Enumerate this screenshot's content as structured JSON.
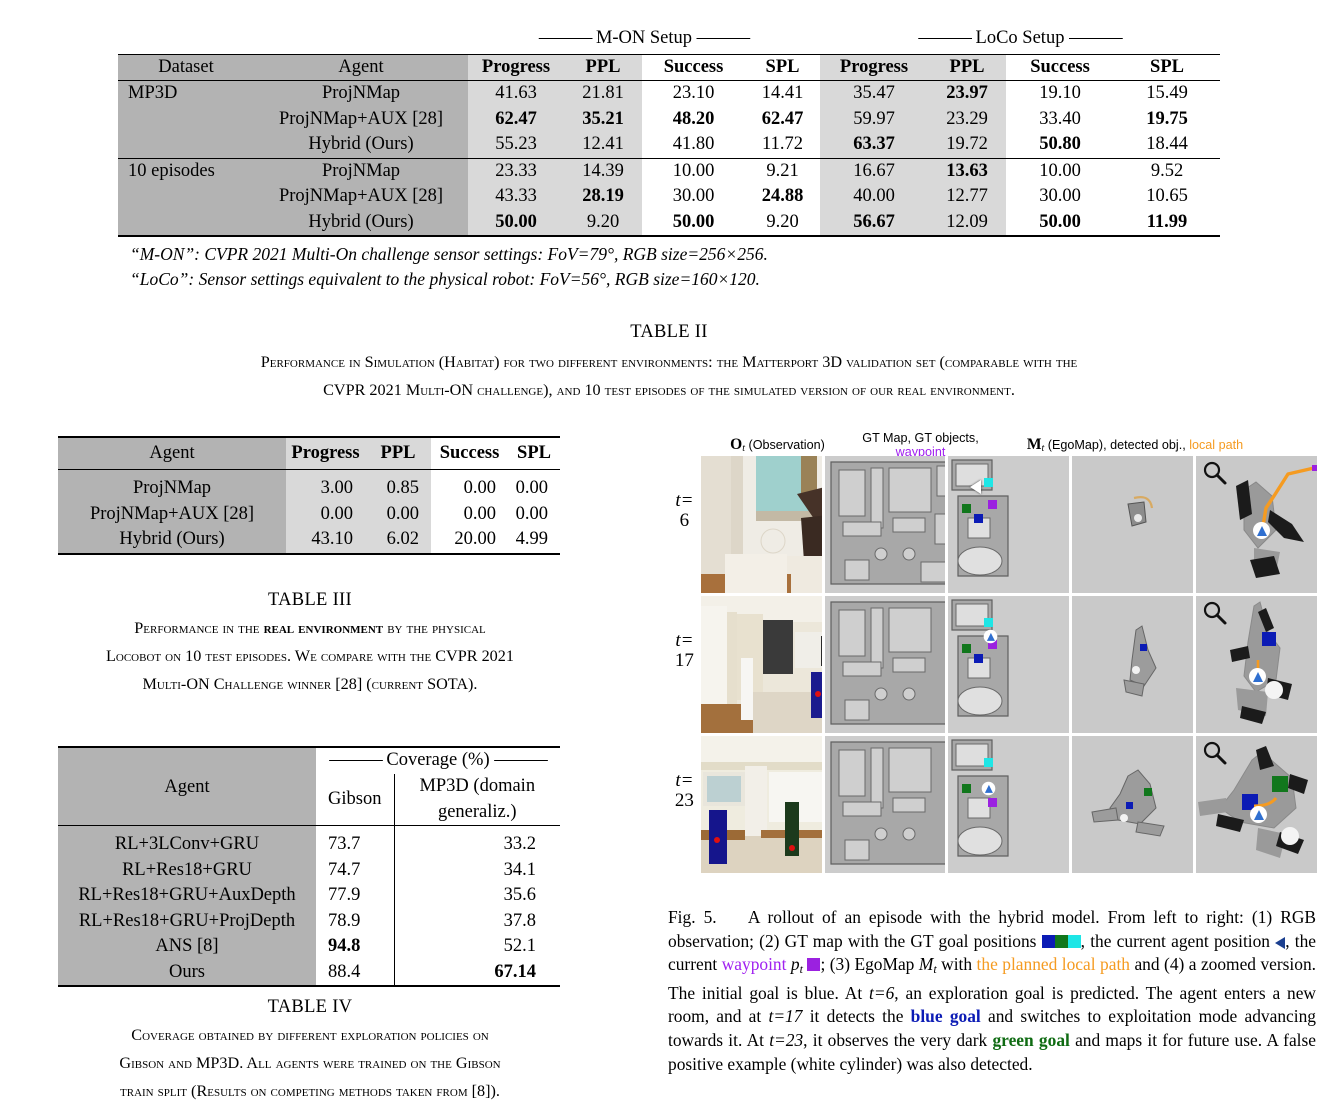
{
  "table2": {
    "group_headers": [
      "M-ON Setup",
      "LoCo Setup"
    ],
    "columns": [
      "Dataset",
      "Agent",
      "Progress",
      "PPL",
      "Success",
      "SPL",
      "Progress",
      "PPL",
      "Success",
      "SPL"
    ],
    "rows": [
      {
        "dataset": "MP3D",
        "agent": "ProjNMap",
        "values": [
          "41.63",
          "21.81",
          "23.10",
          "14.41",
          "35.47",
          "23.97",
          "19.10",
          "15.49"
        ],
        "bold": [
          false,
          false,
          false,
          false,
          false,
          true,
          false,
          false
        ]
      },
      {
        "dataset": "",
        "agent": "ProjNMap+AUX [28]",
        "values": [
          "62.47",
          "35.21",
          "48.20",
          "62.47",
          "59.97",
          "23.29",
          "33.40",
          "19.75"
        ],
        "bold": [
          true,
          true,
          true,
          true,
          false,
          false,
          false,
          true
        ]
      },
      {
        "dataset": "",
        "agent": "Hybrid (Ours)",
        "values": [
          "55.23",
          "12.41",
          "41.80",
          "11.72",
          "63.37",
          "19.72",
          "50.80",
          "18.44"
        ],
        "bold": [
          false,
          false,
          false,
          false,
          true,
          false,
          true,
          false
        ]
      },
      {
        "dataset": "10 episodes",
        "agent": "ProjNMap",
        "values": [
          "23.33",
          "14.39",
          "10.00",
          "9.21",
          "16.67",
          "13.63",
          "10.00",
          "9.52"
        ],
        "bold": [
          false,
          false,
          false,
          false,
          false,
          true,
          false,
          false
        ]
      },
      {
        "dataset": "",
        "agent": "ProjNMap+AUX [28]",
        "values": [
          "43.33",
          "28.19",
          "30.00",
          "24.88",
          "40.00",
          "12.77",
          "30.00",
          "10.65"
        ],
        "bold": [
          false,
          true,
          false,
          true,
          false,
          false,
          false,
          false
        ]
      },
      {
        "dataset": "",
        "agent": "Hybrid (Ours)",
        "values": [
          "50.00",
          "9.20",
          "50.00",
          "9.20",
          "56.67",
          "12.09",
          "50.00",
          "11.99"
        ],
        "bold": [
          true,
          false,
          true,
          false,
          true,
          false,
          true,
          true
        ]
      }
    ],
    "footnotes": [
      "“M-ON”: CVPR 2021 Multi-On challenge sensor settings: FoV=79°, RGB size=256×256.",
      "“LoCo”: Sensor settings equivalent to the physical robot: FoV=56°, RGB size=160×120."
    ],
    "caption_title": "TABLE II",
    "caption_line1": "Performance in Simulation (Habitat) for two different environments: the Matterport 3D validation set (comparable with the",
    "caption_line2": "CVPR 2021 Multi-ON challenge), and 10 test episodes of the simulated version of our real environment."
  },
  "table3": {
    "columns": [
      "Agent",
      "Progress",
      "PPL",
      "Success",
      "SPL"
    ],
    "rows": [
      {
        "agent": "ProjNMap",
        "values": [
          "3.00",
          "0.85",
          "0.00",
          "0.00"
        ]
      },
      {
        "agent": "ProjNMap+AUX [28]",
        "values": [
          "0.00",
          "0.00",
          "0.00",
          "0.00"
        ]
      },
      {
        "agent": "Hybrid (Ours)",
        "values": [
          "43.10",
          "6.02",
          "20.00",
          "4.99"
        ]
      }
    ],
    "caption_title": "TABLE III",
    "caption_line1_a": "Performance in the ",
    "caption_line1_b": "real environment",
    "caption_line1_c": " by the physical",
    "caption_line2": "Locobot on 10 test episodes. We compare with the CVPR 2021",
    "caption_line3": "Multi-ON Challenge winner [28] (current SOTA)."
  },
  "table4": {
    "group_header": "Coverage (%)",
    "columns": [
      "Agent",
      "Gibson",
      "MP3D (domain generaliz.)"
    ],
    "rows": [
      {
        "agent": "RL+3LConv+GRU",
        "gibson": "73.7",
        "mp3d": "33.2",
        "gibson_bold": false,
        "mp3d_bold": false
      },
      {
        "agent": "RL+Res18+GRU",
        "gibson": "74.7",
        "mp3d": "34.1",
        "gibson_bold": false,
        "mp3d_bold": false
      },
      {
        "agent": "RL+Res18+GRU+AuxDepth",
        "gibson": "77.9",
        "mp3d": "35.6",
        "gibson_bold": false,
        "mp3d_bold": false
      },
      {
        "agent": "RL+Res18+GRU+ProjDepth",
        "gibson": "78.9",
        "mp3d": "37.8",
        "gibson_bold": false,
        "mp3d_bold": false
      },
      {
        "agent": "ANS [8]",
        "gibson": "94.8",
        "mp3d": "52.1",
        "gibson_bold": true,
        "mp3d_bold": false
      },
      {
        "agent": "Ours",
        "gibson": "88.4",
        "mp3d": "67.14",
        "gibson_bold": false,
        "mp3d_bold": true
      }
    ],
    "caption_title": "TABLE IV",
    "caption_line1": "Coverage obtained by different exploration policies on",
    "caption_line2": "Gibson and MP3D. All agents were trained on the Gibson",
    "caption_line3": "train split (Results on competing methods taken from [8])."
  },
  "figure5": {
    "column_headers": [
      {
        "math": "O",
        "sub": "t",
        "rest": " (Observation)"
      },
      {
        "plain_a": "GT Map, GT objects, ",
        "highlight": "waypoint"
      },
      {
        "math": "M",
        "sub": "t",
        "plain_a": " (EgoMap), detected obj., ",
        "highlight": "local path"
      }
    ],
    "row_labels": [
      {
        "prefix": "t=",
        "value": "6"
      },
      {
        "prefix": "t=",
        "value": "17"
      },
      {
        "prefix": "t=",
        "value": "23"
      }
    ],
    "panel_names": [
      "RGB observation",
      "GT map",
      "EgoMap",
      "Zoomed EgoMap"
    ],
    "zoom_icon": "magnifier-icon",
    "colors": {
      "goal_blue": "#0b1bb5",
      "goal_green": "#11771c",
      "goal_cyan": "#1ee6e6",
      "waypoint_purple": "#9b21e0",
      "local_path_orange": "#f59b21",
      "map_free": "#aaaaaa",
      "map_bg": "#cccccc"
    },
    "caption": {
      "figno": "Fig. 5.",
      "p1": "A rollout of an episode with the hybrid model. From left to right: (1) RGB observation; (2) GT map with the GT goal positions ",
      "p2": ", the current agent position ",
      "p3": ", the current ",
      "waypoint_word": "waypoint",
      "p_t": "p",
      "p_t_sub": "t",
      "p4": "; (3) EgoMap ",
      "m_t": "M",
      "m_t_sub": "t",
      "p5": " with ",
      "local_path_phrase": "the planned local path",
      "p6": " and (4) a zoomed version. The initial goal is blue. At ",
      "t6": "t=6",
      "p7": ", an exploration goal is predicted. The agent enters a new room, and at ",
      "t17": "t=17",
      "p8": " it detects the ",
      "blue_goal": "blue goal",
      "p9": " and switches to exploitation mode advancing towards it. At ",
      "t23": "t=23",
      "p10": ", it observes the very dark ",
      "green_goal": "green goal",
      "p11": " and maps it for future use. A false positive example (white cylinder) was also detected."
    }
  }
}
